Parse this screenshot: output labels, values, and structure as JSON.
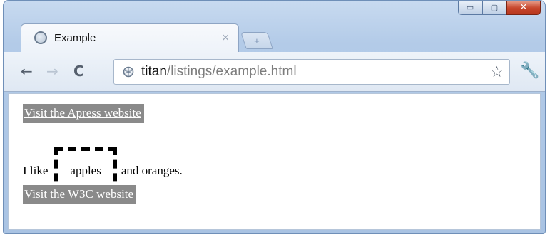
{
  "window": {
    "caption_buttons": {
      "minimize": "▭",
      "maximize": "▢",
      "close": "✕"
    }
  },
  "tab": {
    "title": "Example",
    "close_glyph": "×",
    "new_tab_glyph": "+"
  },
  "toolbar": {
    "back_glyph": "←",
    "forward_glyph": "→",
    "reload_glyph": "C",
    "url_host": "titan",
    "url_path": "/listings/example.html",
    "bookmark_glyph": "☆",
    "menu_glyph": "🔧"
  },
  "page": {
    "link1": "Visit the Apress website",
    "sentence_before": "I like",
    "fruit": "apples",
    "sentence_after": "and oranges.",
    "link2": "Visit the W3C website"
  },
  "colors": {
    "link_background": "#8a8a8a",
    "link_text": "#ffffff",
    "frame": "#b3cbe8",
    "close_button": "#c6452b"
  },
  "icons": [
    "globe-icon",
    "close-icon",
    "new-tab-icon",
    "back-arrow-icon",
    "forward-arrow-icon",
    "reload-icon",
    "star-icon",
    "wrench-icon"
  ]
}
